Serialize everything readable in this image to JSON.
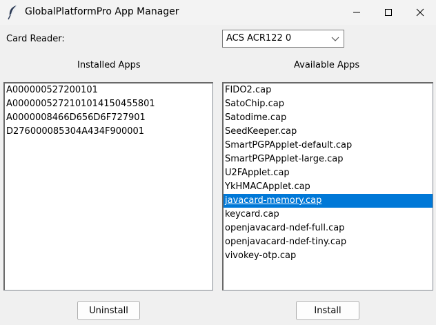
{
  "window": {
    "title": "GlobalPlatformPro App Manager",
    "icon": "feather-icon"
  },
  "reader": {
    "label": "Card Reader:",
    "selected": "ACS ACR122 0"
  },
  "installed": {
    "heading": "Installed Apps",
    "items": [
      "A000000527200101",
      "A000000527210101415045580 1",
      "A0000008466D656D6F727901",
      "D276000085304A434F900001"
    ]
  },
  "available": {
    "heading": "Available Apps",
    "selected_index": 8,
    "items": [
      "FIDO2.cap",
      "SatoChip.cap",
      "Satodime.cap",
      "SeedKeeper.cap",
      "SmartPGPApplet-default.cap",
      "SmartPGPApplet-large.cap",
      "U2FApplet.cap",
      "YkHMACApplet.cap",
      "javacard-memory.cap",
      "keycard.cap",
      "openjavacard-ndef-full.cap",
      "openjavacard-ndef-tiny.cap",
      "vivokey-otp.cap"
    ]
  },
  "actions": {
    "uninstall": "Uninstall",
    "install": "Install"
  },
  "colors": {
    "selection": "#0078d7",
    "window_bg": "#f0f0f0"
  }
}
